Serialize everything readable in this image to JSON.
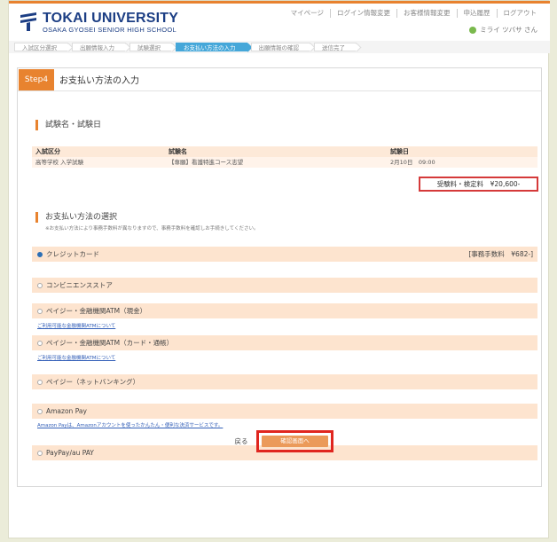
{
  "header": {
    "logo_title": "TOKAI UNIVERSITY",
    "logo_sub": "OSAKA GYOSEI SENIOR HIGH SCHOOL",
    "nav": [
      "マイページ",
      "ログイン情報変更",
      "お客様情報変更",
      "申込履歴",
      "ログアウト"
    ],
    "user": "ミライ ツバサ さん"
  },
  "steps": [
    "入試区分選択",
    "出願情報入力",
    "試験選択",
    "お支払い方法の入力",
    "出願情報の確認",
    "送信完了"
  ],
  "step": {
    "badge": "Step4",
    "title": "お支払い方法の入力"
  },
  "exam": {
    "section_title": "試験名・試験日",
    "headers": [
      "入試区分",
      "試験名",
      "試験日"
    ],
    "row": [
      "高等学校 入学試験",
      "【専願】看護特進コース志望",
      "2月10日　09:00"
    ],
    "fee": "受験料・検定料　¥20,600-"
  },
  "payment": {
    "section_title": "お支払い方法の選択",
    "note": "※お支払い方法により事務手数料が異なりますので、事務手数料を確認しお手続きしてください。",
    "methods": [
      {
        "label": "クレジットカード",
        "fee": "[事務手数料　¥682-]",
        "selected": true
      },
      {
        "label": "コンビニエンスストア",
        "fee": "",
        "selected": false
      },
      {
        "label": "ペイジー・金融機関ATM（現金）",
        "fee": "",
        "link": "ご利用可能な金融機関ATMについて",
        "selected": false
      },
      {
        "label": "ペイジー・金融機関ATM（カード・通帳）",
        "fee": "",
        "link": "ご利用可能な金融機関ATMについて",
        "selected": false
      },
      {
        "label": "ペイジー（ネットバンキング）",
        "fee": "",
        "selected": false
      },
      {
        "label": "Amazon Pay",
        "fee": "",
        "link": "Amazon Payは、Amazonアカウントを使ったかんたん・便利な決済サービスです。",
        "selected": false
      },
      {
        "label": "PayPay/au PAY",
        "fee": "",
        "selected": false
      }
    ]
  },
  "buttons": {
    "back": "戻る",
    "confirm": "確認画面へ"
  },
  "colors": {
    "accent": "#e8832f",
    "highlight": "#e0261f",
    "brand": "#1c3e84"
  }
}
